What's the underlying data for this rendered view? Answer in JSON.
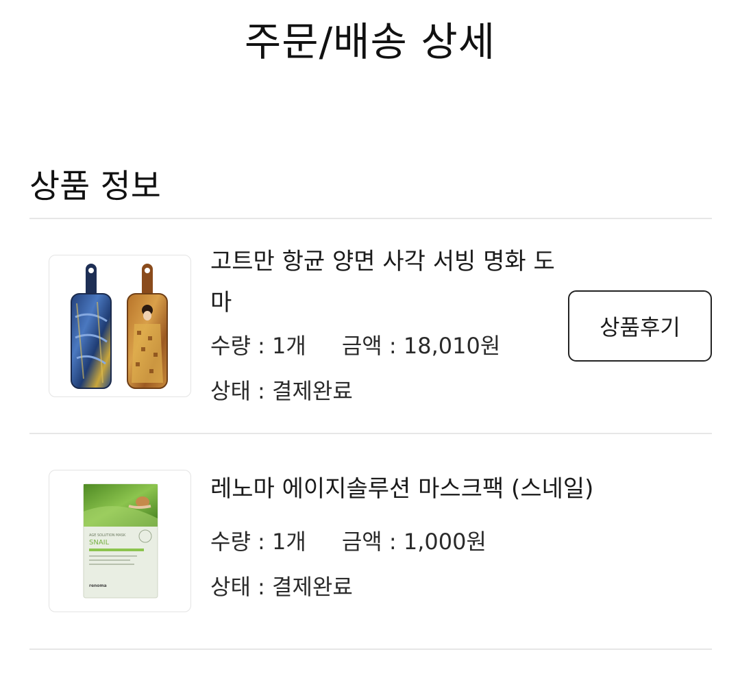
{
  "header": {
    "title": "주문/배송 상세"
  },
  "section": {
    "title": "상품 정보"
  },
  "products": [
    {
      "name": "고트만 항균 양면 사각 서빙 명화 도마",
      "qty_label": "수량 : ",
      "qty": "1개",
      "price_label": "금액 : ",
      "price": "18,010원",
      "status_label": "상태 : ",
      "status": "결제완료",
      "review_button": "상품후기",
      "image": "cutting-boards-painting"
    },
    {
      "name": "레노마 에이지솔루션 마스크팩 (스네일)",
      "qty_label": "수량 : ",
      "qty": "1개",
      "price_label": "금액 : ",
      "price": "1,000원",
      "status_label": "상태 : ",
      "status": "결제완료",
      "image": "snail-mask-pack",
      "image_text": {
        "line1": "AGE SOLUTION MASK",
        "line2": "SNAIL",
        "brand": "renoma"
      }
    }
  ],
  "colors": {
    "divider": "#e6e6e6",
    "button_border": "#222222",
    "leaf_green": "#6fae3a"
  }
}
